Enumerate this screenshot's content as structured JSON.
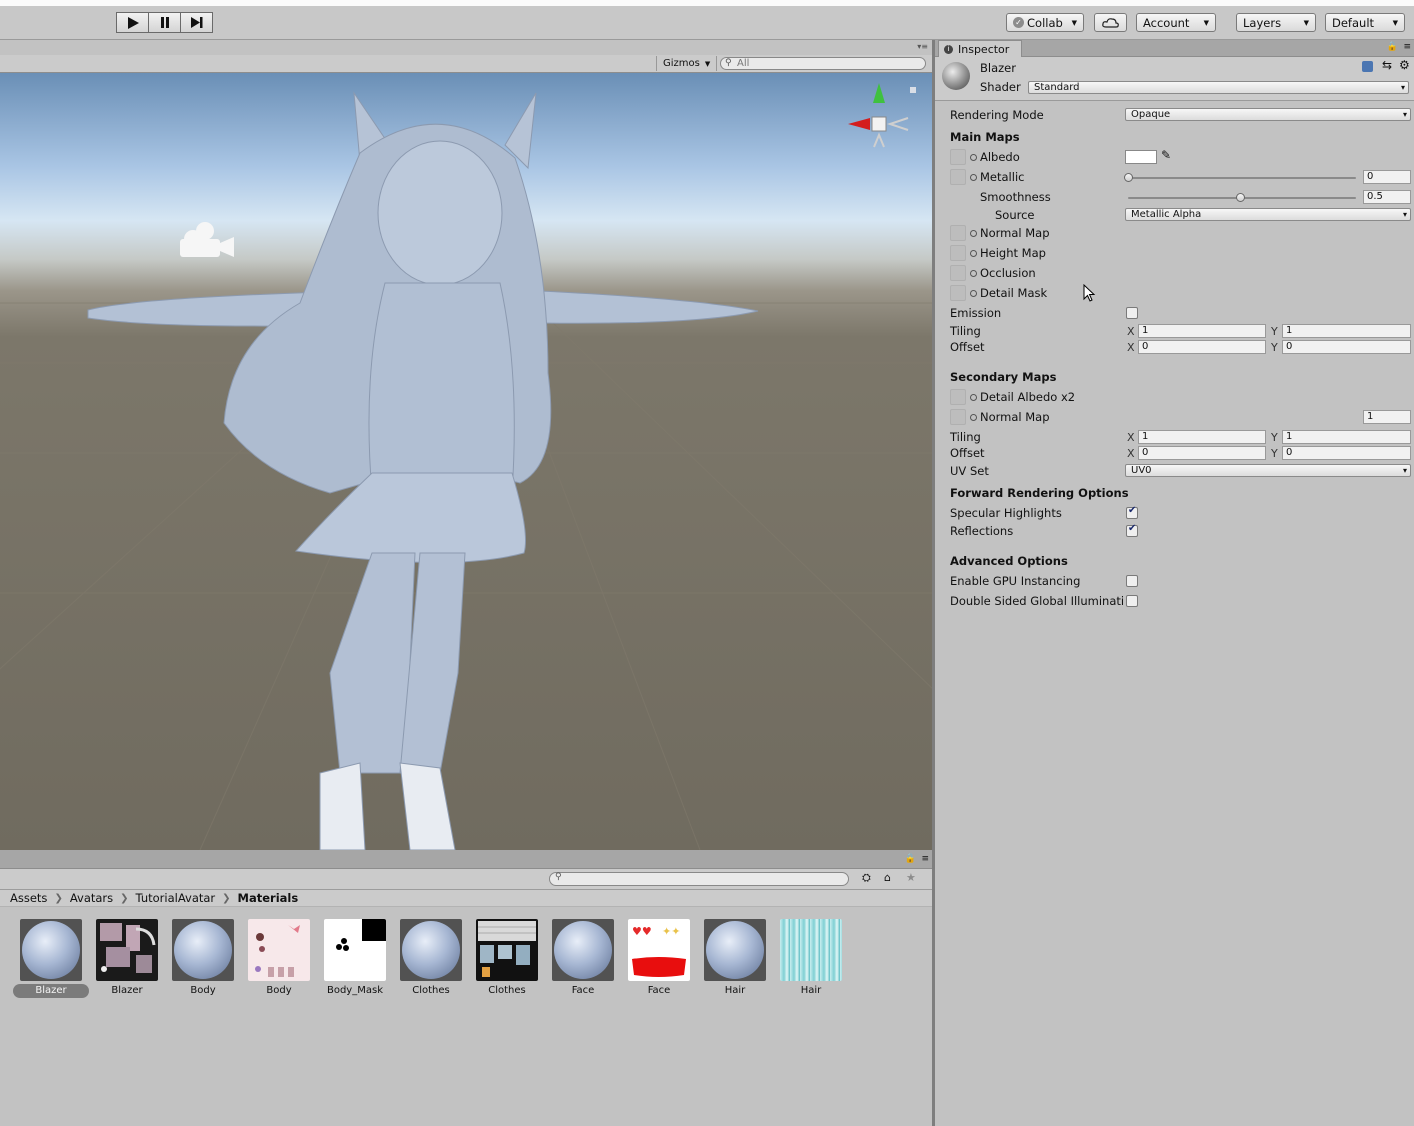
{
  "toolbar": {
    "collab_label": "Collab",
    "account_label": "Account",
    "layers_label": "Layers",
    "layout_label": "Default"
  },
  "scene": {
    "gizmos_label": "Gizmos",
    "search_placeholder": "All"
  },
  "inspector": {
    "tab_label": "Inspector",
    "material_name": "Blazer",
    "shader_label": "Shader",
    "shader_value": "Standard",
    "rendering_mode_label": "Rendering Mode",
    "rendering_mode_value": "Opaque",
    "main_maps_title": "Main Maps",
    "albedo_label": "Albedo",
    "albedo_color": "#ffffff",
    "metallic_label": "Metallic",
    "metallic_value": "0",
    "smoothness_label": "Smoothness",
    "smoothness_value": "0.5",
    "source_label": "Source",
    "source_value": "Metallic Alpha",
    "normal_map_label": "Normal Map",
    "height_map_label": "Height Map",
    "occlusion_label": "Occlusion",
    "detail_mask_label": "Detail Mask",
    "emission_label": "Emission",
    "emission_checked": false,
    "tiling_label": "Tiling",
    "offset_label": "Offset",
    "main_tiling_x": "1",
    "main_tiling_y": "1",
    "main_offset_x": "0",
    "main_offset_y": "0",
    "secondary_maps_title": "Secondary Maps",
    "detail_albedo_label": "Detail Albedo x2",
    "secondary_normal_label": "Normal Map",
    "secondary_normal_value": "1",
    "sec_tiling_x": "1",
    "sec_tiling_y": "1",
    "sec_offset_x": "0",
    "sec_offset_y": "0",
    "uv_set_label": "UV Set",
    "uv_set_value": "UV0",
    "forward_title": "Forward Rendering Options",
    "specular_label": "Specular Highlights",
    "specular_checked": true,
    "reflections_label": "Reflections",
    "reflections_checked": true,
    "advanced_title": "Advanced Options",
    "gpu_instancing_label": "Enable GPU Instancing",
    "gpu_instancing_checked": false,
    "double_sided_label": "Double Sided Global Illuminati",
    "double_sided_checked": false,
    "x_label": "X",
    "y_label": "Y"
  },
  "project": {
    "breadcrumb": [
      "Assets",
      "Avatars",
      "TutorialAvatar",
      "Materials"
    ],
    "assets": [
      {
        "name": "Blazer",
        "kind": "material",
        "selected": true
      },
      {
        "name": "Blazer",
        "kind": "texture"
      },
      {
        "name": "Body",
        "kind": "material"
      },
      {
        "name": "Body",
        "kind": "texture"
      },
      {
        "name": "Body_Mask",
        "kind": "texture"
      },
      {
        "name": "Clothes",
        "kind": "material"
      },
      {
        "name": "Clothes",
        "kind": "texture"
      },
      {
        "name": "Face",
        "kind": "material"
      },
      {
        "name": "Face",
        "kind": "texture"
      },
      {
        "name": "Hair",
        "kind": "material"
      },
      {
        "name": "Hair",
        "kind": "texture"
      }
    ]
  }
}
